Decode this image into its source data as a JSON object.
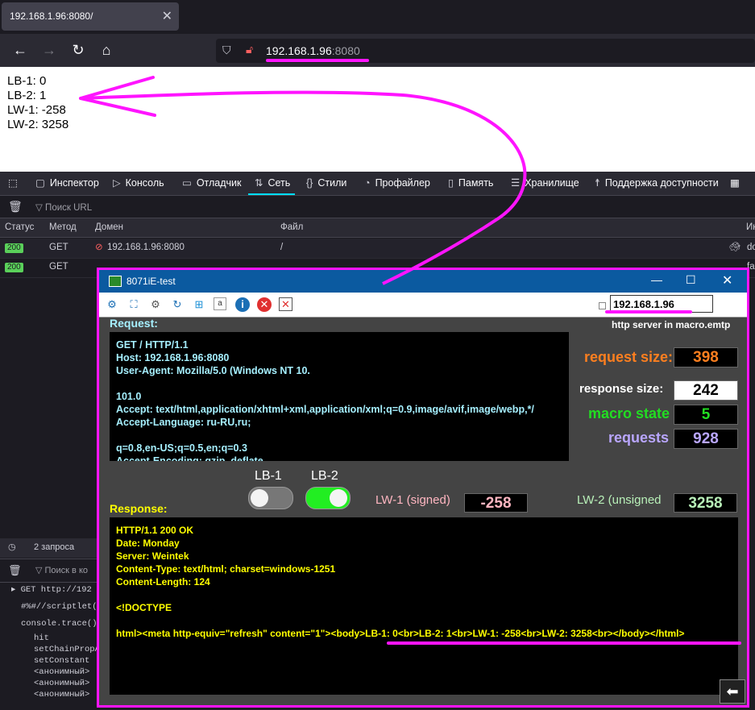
{
  "browser": {
    "tab_title": "192.168.1.96:8080/",
    "url_host": "192.168.1.96",
    "url_port": ":8080"
  },
  "page_lines": [
    "LB-1: 0",
    "LB-2: 1",
    "LW-1: -258",
    "LW-2: 3258"
  ],
  "devtools": {
    "tabs": [
      "Инспектор",
      "Консоль",
      "Отладчик",
      "Сеть",
      "Стили",
      "Профайлер",
      "Память",
      "Хранилище",
      "Поддержка доступности"
    ],
    "filter_placeholder": "Поиск URL",
    "columns": [
      "Статус",
      "Метод",
      "Домен",
      "Файл",
      "Ин"
    ],
    "rows": [
      {
        "status": "200",
        "method": "GET",
        "domain": "192.168.1.96:8080",
        "file": "/",
        "extra": "do"
      },
      {
        "status": "200",
        "method": "GET",
        "domain": "",
        "file": "",
        "extra": "fa"
      }
    ],
    "requests_count": "2 запроса",
    "console_filter": "Поиск в ко",
    "console_lines": [
      "GET http://192",
      "#%#//scriptlet(",
      "console.trace()",
      "hit",
      "setChainPropA",
      "setConstant",
      "<анонимный>",
      "<анонимный>",
      "<анонимный>"
    ]
  },
  "app": {
    "title": "8071iE-test",
    "ip": "192.168.1.96",
    "server_label": "http server in macro.emtp",
    "request_label": "Request:",
    "request_text": "GET / HTTP/1.1\nHost: 192.168.1.96:8080\nUser-Agent: Mozilla/5.0 (Windows NT 10.\n\n101.0\nAccept: text/html,application/xhtml+xml,application/xml;q=0.9,image/avif,image/webp,*/\nAccept-Language: ru-RU,ru;\n\nq=0.8,en-US;q=0.5,en;q=0.3\nAccept-Encoding: gzip, deflate",
    "response_label": "Response:",
    "response_text": "HTTP/1.1 200 OK\nDate: Monday\nServer: Weintek\nContent-Type: text/html; charset=windows-1251\nContent-Length: 124\n\n<!DOCTYPE\n\nhtml><meta http-equiv=\"refresh\" content=\"1\"><body>LB-1: 0<br>LB-2: 1<br>LW-1: -258<br>LW-2: 3258<br></body></html>",
    "request_size_label": "request size:",
    "request_size": "398",
    "response_size_label": "response size:",
    "response_size": "242",
    "macro_state_label": "macro state",
    "macro_state": "5",
    "requests_label": "requests",
    "requests": "928",
    "lb1_label": "LB-1",
    "lb2_label": "LB-2",
    "lb1_on": false,
    "lb2_on": true,
    "lw1_label": "LW-1 (signed)",
    "lw1_value": "-258",
    "lw2_label": "LW-2 (unsigned",
    "lw2_value": "3258"
  },
  "colors": {
    "annotation": "#ff14ff",
    "request_size": "#ff7f1f",
    "macro_state": "#22dd22",
    "requests": "#b9a6ff",
    "lw1": "#ffb6c1",
    "lw2": "#b8f0b8",
    "response_text": "#ffff00",
    "request_text": "#a6f0ff"
  }
}
